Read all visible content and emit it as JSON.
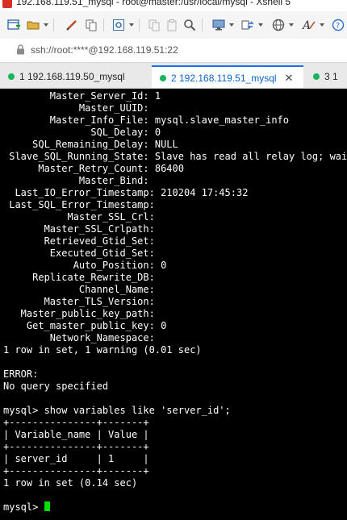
{
  "window": {
    "title": "192.168.119.51_mysql - root@master:/usr/local/mysql - Xshell 5"
  },
  "address": {
    "text": "ssh://root:****@192.168.119.51:22"
  },
  "tabs": [
    {
      "label": "1 192.168.119.50_mysql",
      "active": false,
      "status_color": "#18b55a"
    },
    {
      "label": "2 192.168.119.51_mysql",
      "active": true,
      "status_color": "#18b55a"
    },
    {
      "label": "3 1",
      "active": false,
      "status_color": "#18b55a"
    }
  ],
  "terminal": {
    "cursor_color": "#00e000",
    "lines": [
      "        Master_Server_Id: 1",
      "             Master_UUID:",
      "        Master_Info_File: mysql.slave_master_info",
      "               SQL_Delay: 0",
      "     SQL_Remaining_Delay: NULL",
      " Slave_SQL_Running_State: Slave has read all relay log; waiting for more updates",
      "      Master_Retry_Count: 86400",
      "             Master_Bind:",
      "  Last_IO_Error_Timestamp: 210204 17:45:32",
      " Last_SQL_Error_Timestamp:",
      "           Master_SSL_Crl:",
      "       Master_SSL_Crlpath:",
      "       Retrieved_Gtid_Set:",
      "        Executed_Gtid_Set:",
      "            Auto_Position: 0",
      "     Replicate_Rewrite_DB:",
      "             Channel_Name:",
      "       Master_TLS_Version:",
      "   Master_public_key_path:",
      "    Get_master_public_key: 0",
      "        Network_Namespace:",
      "1 row in set, 1 warning (0.01 sec)",
      "",
      "ERROR:",
      "No query specified",
      "",
      "mysql> show variables like 'server_id';",
      "+---------------+-------+",
      "| Variable_name | Value |",
      "+---------------+-------+",
      "| server_id     | 1     |",
      "+---------------+-------+",
      "1 row in set (0.14 sec)",
      "",
      "mysql> "
    ]
  }
}
